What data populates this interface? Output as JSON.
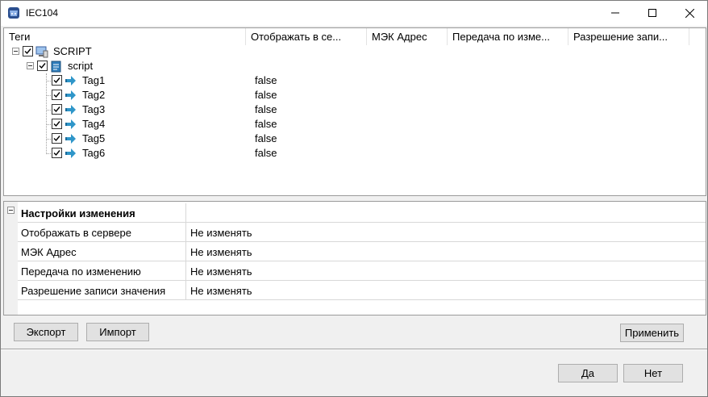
{
  "window": {
    "title": "IEC104"
  },
  "tree": {
    "columns": [
      "Теги",
      "Отображать в се...",
      "МЭК Адрес",
      "Передача по изме...",
      "Разрешение запи..."
    ],
    "root": {
      "label": "SCRIPT",
      "checked": true
    },
    "child": {
      "label": "script",
      "checked": true
    },
    "tags": [
      {
        "label": "Tag1",
        "value": "false"
      },
      {
        "label": "Tag2",
        "value": "false"
      },
      {
        "label": "Tag3",
        "value": "false"
      },
      {
        "label": "Tag4",
        "value": "false"
      },
      {
        "label": "Tag5",
        "value": "false"
      },
      {
        "label": "Tag6",
        "value": "false"
      }
    ]
  },
  "properties": {
    "category": "Настройки изменения",
    "rows": [
      {
        "name": "Отображать в сервере",
        "value": "Не изменять"
      },
      {
        "name": "МЭК Адрес",
        "value": "Не изменять"
      },
      {
        "name": "Передача по изменению",
        "value": "Не изменять"
      },
      {
        "name": "Разрешение записи значения",
        "value": "Не изменять"
      }
    ]
  },
  "buttons": {
    "export": "Экспорт",
    "import": "Импорт",
    "apply": "Применить",
    "ok": "Да",
    "cancel": "Нет"
  }
}
